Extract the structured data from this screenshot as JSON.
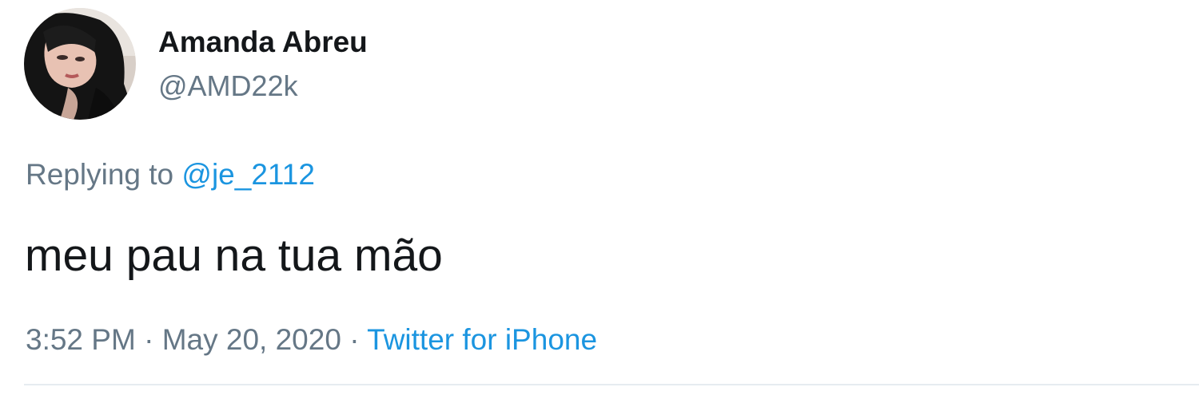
{
  "user": {
    "display_name": "Amanda Abreu",
    "handle": "@AMD22k",
    "avatar_icon": "profile-photo"
  },
  "reply": {
    "prefix": "Replying to",
    "mention": "@je_2112"
  },
  "tweet": {
    "text": "meu pau na tua mão"
  },
  "meta": {
    "time": "3:52 PM",
    "separator": "·",
    "date": "May 20, 2020",
    "source": "Twitter for iPhone"
  },
  "colors": {
    "text": "#14171a",
    "secondary": "#657786",
    "link": "#1b95e0",
    "divider": "#e6ecf0"
  }
}
